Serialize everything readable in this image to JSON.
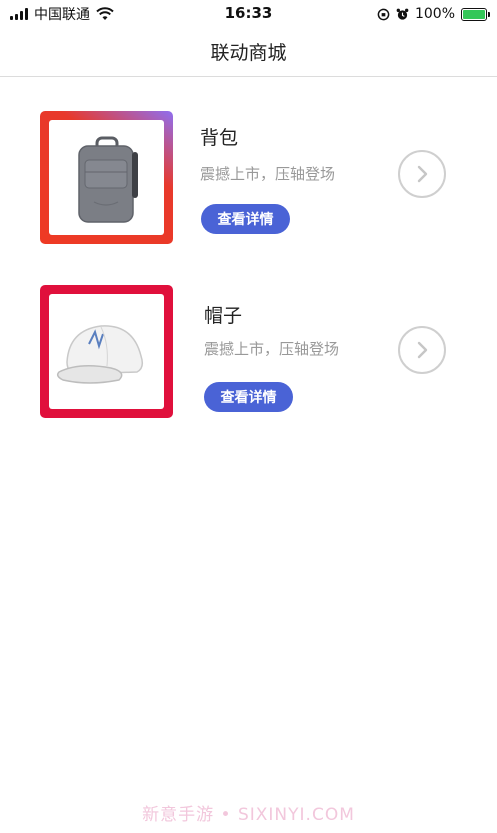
{
  "status_bar": {
    "carrier": "中国联通",
    "time": "16:33",
    "battery": "100%"
  },
  "nav": {
    "title": "联动商城"
  },
  "products": [
    {
      "name": "背包",
      "description": "震撼上市，压轴登场",
      "button_label": "查看详情",
      "image_icon": "backpack-image"
    },
    {
      "name": "帽子",
      "description": "震撼上市，压轴登场",
      "button_label": "查看详情",
      "image_icon": "cap-image"
    }
  ],
  "colors": {
    "button": "#4a63d6",
    "frame_1": "#e8392b",
    "frame_2": "#e0103c"
  },
  "watermark": "新意手游 • SIXINYI.COM"
}
